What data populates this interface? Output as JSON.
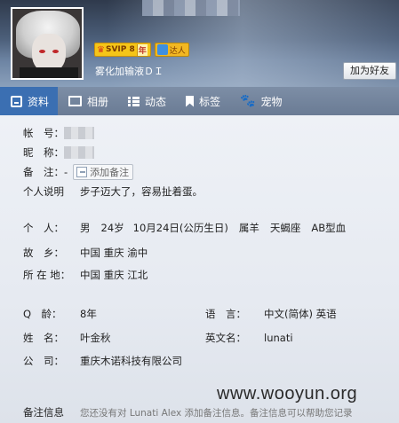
{
  "header": {
    "nickname": "雾化加输液ＤＩ",
    "vip_badge": "SVIP 8",
    "vip_year": "年",
    "daren_badge": "达人",
    "add_friend_label": "加为好友"
  },
  "tabs": [
    {
      "label": "资料",
      "icon": "profile-icon",
      "active": true
    },
    {
      "label": "相册",
      "icon": "album-icon"
    },
    {
      "label": "动态",
      "icon": "feed-icon"
    },
    {
      "label": "标签",
      "icon": "tag-icon"
    },
    {
      "label": "宠物",
      "icon": "pet-icon"
    }
  ],
  "profile": {
    "account_label": "帐　号：",
    "nickname_label": "昵　称：",
    "note_label": "备　注：",
    "note_value": "-",
    "add_note_label": "添加备注",
    "bio_label": "个人说明",
    "bio_value": "步子迈大了，容易扯着蛋。",
    "personal_label": "个　人：",
    "gender": "男",
    "age": "24岁",
    "birthday": "10月24日(公历生日)",
    "zodiac_cn": "属羊",
    "zodiac": "天蝎座",
    "blood": "AB型血",
    "hometown_label": "故　乡：",
    "hometown_value": "中国  重庆  渝中",
    "location_label": "所 在 地：",
    "location_value": "中国  重庆  江北",
    "qage_label": "Q　龄：",
    "qage_value": "8年",
    "language_label": "语　言：",
    "language_value": "中文(简体)  英语",
    "name_label": "姓　名：",
    "name_value": "叶金秋",
    "english_name_label": "英文名：",
    "english_name_value": "lunati",
    "company_label": "公　司：",
    "company_value": "重庆木诺科技有限公司",
    "remark_label": "备注信息",
    "remark_value": "您还没有对 Lunati Alex 添加备注信息。备注信息可以帮助您记录"
  },
  "watermark": "www.wooyun.org"
}
